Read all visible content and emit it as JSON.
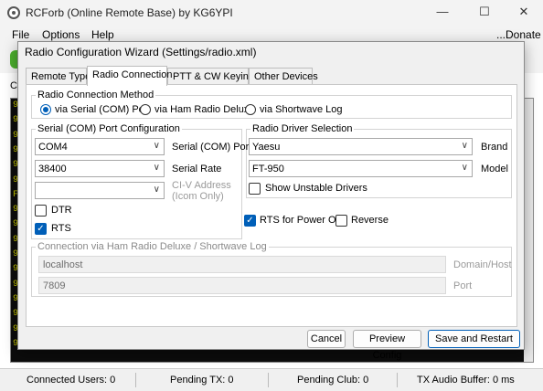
{
  "main_window": {
    "title": "RCForb (Online Remote Base) by KG6YPI",
    "controls": {
      "minimize": "—",
      "maximize": "☐",
      "close": "✕"
    },
    "menu": [
      "File",
      "Options",
      "Help"
    ],
    "donate": "...Donate",
    "tab_label": "C",
    "console_chars": [
      "9",
      "9",
      "9",
      "9",
      "9",
      "9",
      "F",
      "9",
      "9",
      "9",
      "9",
      "9",
      "9",
      "9",
      "9",
      "9",
      "9"
    ],
    "status": {
      "connected_users": "Connected Users: 0",
      "pending_tx": "Pending TX: 0",
      "pending_club": "Pending Club: 0",
      "tx_audio_buffer": "TX Audio Buffer: 0 ms"
    }
  },
  "dialog": {
    "title": "Radio Configuration Wizard (Settings/radio.xml)",
    "tabs": [
      "Remote Type",
      "Radio Connection",
      "PTT & CW Keying",
      "Other Devices"
    ],
    "active_tab": 1,
    "connection_method": {
      "legend": "Radio Connection Method",
      "options": [
        "via Serial (COM) Port",
        "via Ham Radio Deluxe",
        "via Shortwave Log"
      ],
      "selected": 0
    },
    "serial": {
      "legend": "Serial (COM) Port Configuration",
      "port_value": "COM4",
      "port_label": "Serial (COM) Port",
      "rate_value": "38400",
      "rate_label": "Serial Rate",
      "civ_value": "",
      "civ_label": "CI-V Address\n(Icom Only)",
      "dtr_label": "DTR",
      "dtr_checked": false,
      "rts_label": "RTS",
      "rts_checked": true
    },
    "driver": {
      "legend": "Radio Driver Selection",
      "brand_value": "Yaesu",
      "brand_label": "Brand",
      "model_value": "FT-950",
      "model_label": "Model",
      "unstable_label": "Show Unstable Drivers",
      "unstable_checked": false
    },
    "rts_power_on_label": "RTS for Power On",
    "rts_power_on_checked": true,
    "reverse_label": "Reverse",
    "reverse_checked": false,
    "hrd": {
      "legend": "Connection via Ham Radio Deluxe / Shortwave Log",
      "domain_value": "localhost",
      "domain_label": "Domain/Host",
      "port_value": "7809",
      "port_label": "Port"
    },
    "buttons": {
      "cancel": "Cancel",
      "preview": "Preview Config",
      "save": "Save and Restart"
    },
    "check_glyph": "✓",
    "arrow_glyph": "∨",
    "accent_color": "#005fb8"
  }
}
